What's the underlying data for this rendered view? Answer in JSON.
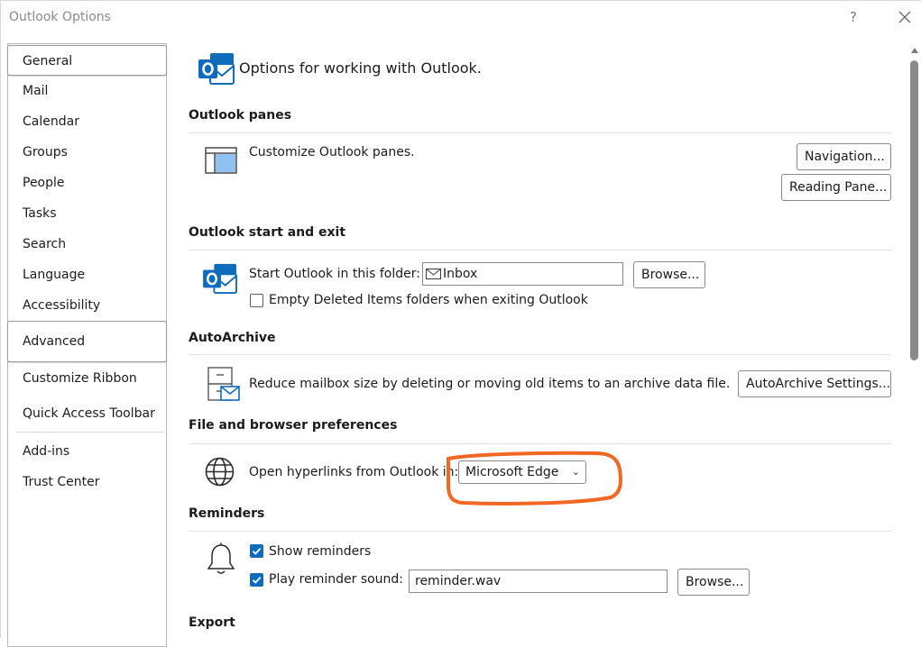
{
  "window": {
    "title": "Outlook Options",
    "help": "?"
  },
  "sidebar": {
    "items": [
      {
        "label": "General",
        "selected": true
      },
      {
        "label": "Mail"
      },
      {
        "label": "Calendar"
      },
      {
        "label": "Groups"
      },
      {
        "label": "People"
      },
      {
        "label": "Tasks"
      },
      {
        "label": "Search"
      },
      {
        "label": "Language"
      },
      {
        "label": "Accessibility"
      },
      {
        "label": "Advanced",
        "selected": true
      },
      {
        "label": "Customize Ribbon"
      },
      {
        "label": "Quick Access Toolbar"
      },
      {
        "label": "Add-ins"
      },
      {
        "label": "Trust Center"
      }
    ]
  },
  "main": {
    "header": "Options for working with Outlook.",
    "panes": {
      "title": "Outlook panes",
      "description": "Customize Outlook panes.",
      "navigation_button": "Navigation...",
      "reading_pane_button": "Reading Pane..."
    },
    "start_exit": {
      "title": "Outlook start and exit",
      "start_folder_label": "Start Outlook in this folder:",
      "start_folder_value": "Inbox",
      "browse_button": "Browse...",
      "empty_deleted_label": "Empty Deleted Items folders when exiting Outlook",
      "empty_deleted_checked": false
    },
    "autoarchive": {
      "title": "AutoArchive",
      "description": "Reduce mailbox size by deleting or moving old items to an archive data file.",
      "settings_button": "AutoArchive Settings..."
    },
    "file_browser": {
      "title": "File and browser preferences",
      "hyperlinks_label": "Open hyperlinks from Outlook in:",
      "browser_value": "Microsoft Edge"
    },
    "reminders": {
      "title": "Reminders",
      "show_reminders_label": "Show reminders",
      "show_reminders_checked": true,
      "play_sound_label": "Play reminder sound:",
      "play_sound_checked": true,
      "sound_file": "reminder.wav",
      "browse_button": "Browse..."
    },
    "export": {
      "title": "Export"
    }
  },
  "colors": {
    "accent": "#0f6cbd",
    "annotation": "#f26722"
  },
  "icons": [
    "close-icon",
    "outlook-logo-icon",
    "panes-icon",
    "archive-icon",
    "globe-icon",
    "bell-icon",
    "envelope-icon",
    "chevron-down-icon"
  ]
}
